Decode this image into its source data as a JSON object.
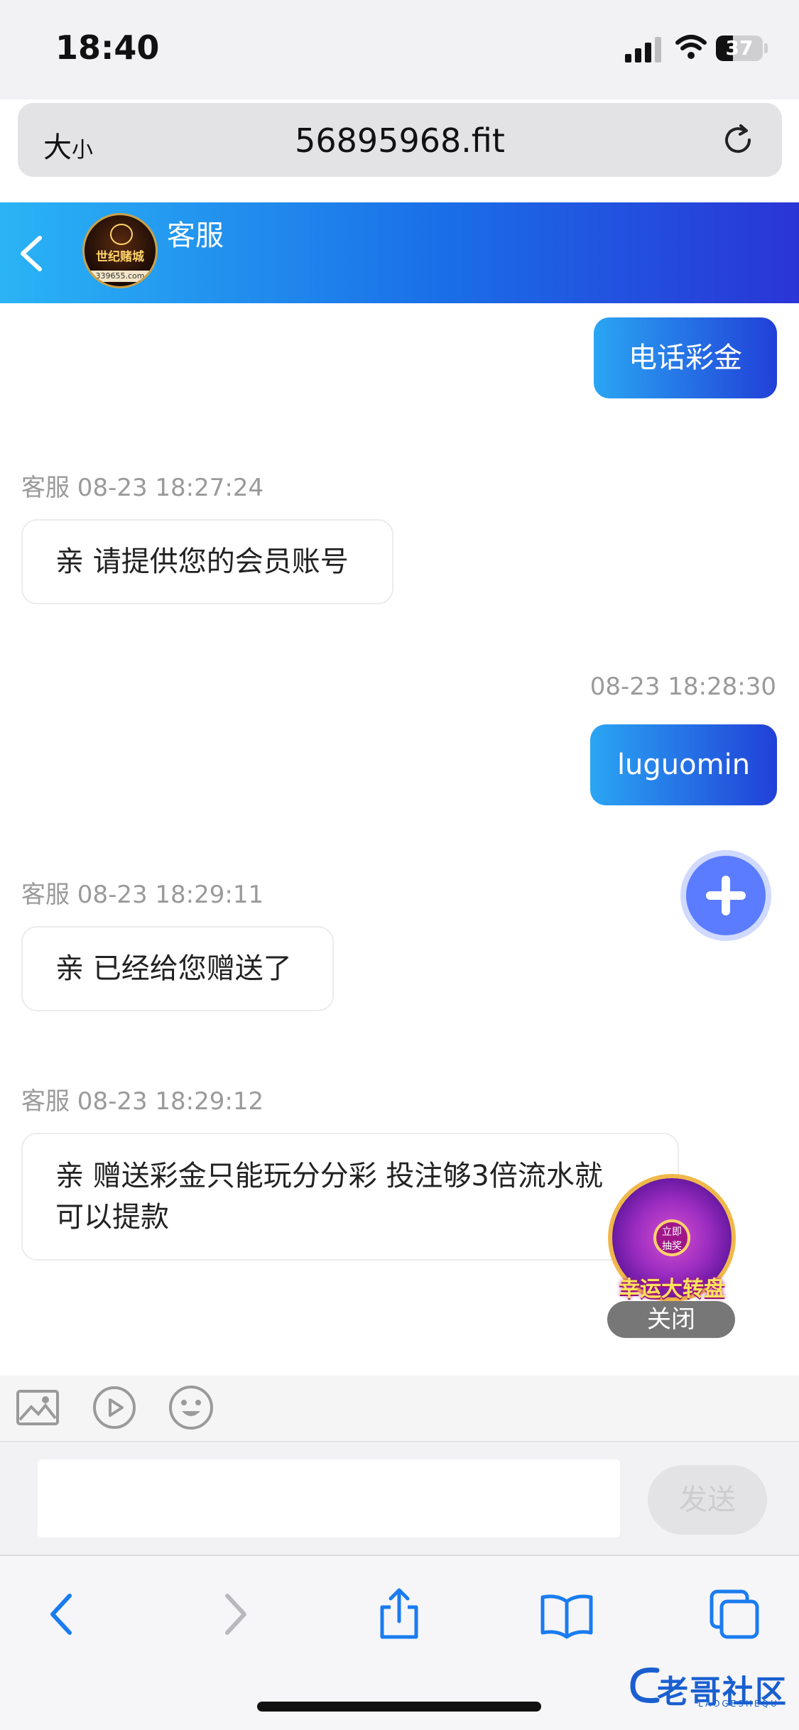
{
  "status_bar": {
    "time": "18:40",
    "battery": "37",
    "battery_level": 0.37
  },
  "browser": {
    "text_size_large": "大",
    "text_size_small": "小",
    "url": "56895968.fit"
  },
  "chat_header": {
    "title": "客服",
    "avatar_logo_text": "世纪赌城",
    "avatar_site_text": "339655.com"
  },
  "messages": {
    "m1": {
      "text": "电话彩金"
    },
    "m2": {
      "meta": "客服 08-23 18:27:24",
      "text": "亲 请提供您的会员账号"
    },
    "m3": {
      "meta": "08-23 18:28:30",
      "text": "luguomin"
    },
    "m4": {
      "meta": "客服 08-23 18:29:11",
      "text": "亲 已经给您赠送了"
    },
    "m5": {
      "meta": "客服 08-23 18:29:12",
      "line1": "亲 赠送彩金只能玩分分彩 投注够3倍流水就",
      "line2": "可以提款"
    }
  },
  "lucky_wheel": {
    "center_line1": "立即",
    "center_line2": "抽奖",
    "label": "幸运大转盘",
    "close": "关闭"
  },
  "input": {
    "send_label": "发送",
    "value": "",
    "placeholder": ""
  },
  "watermark": {
    "title": "老哥社区",
    "subtitle": "LAOGESHEQU"
  },
  "colors": {
    "header_gradient": [
      "#2ab4f5",
      "#2a35d6"
    ],
    "outgoing_bubble": [
      "#2aa6f3",
      "#2140d8"
    ],
    "fab": "#5b7cff",
    "ios_blue": "#1a7cf0"
  },
  "icons": [
    "back-chevron-icon",
    "reload-icon",
    "plus-icon",
    "image-icon",
    "video-play-icon",
    "emoji-icon",
    "share-icon",
    "bookmarks-icon",
    "tabs-icon"
  ]
}
